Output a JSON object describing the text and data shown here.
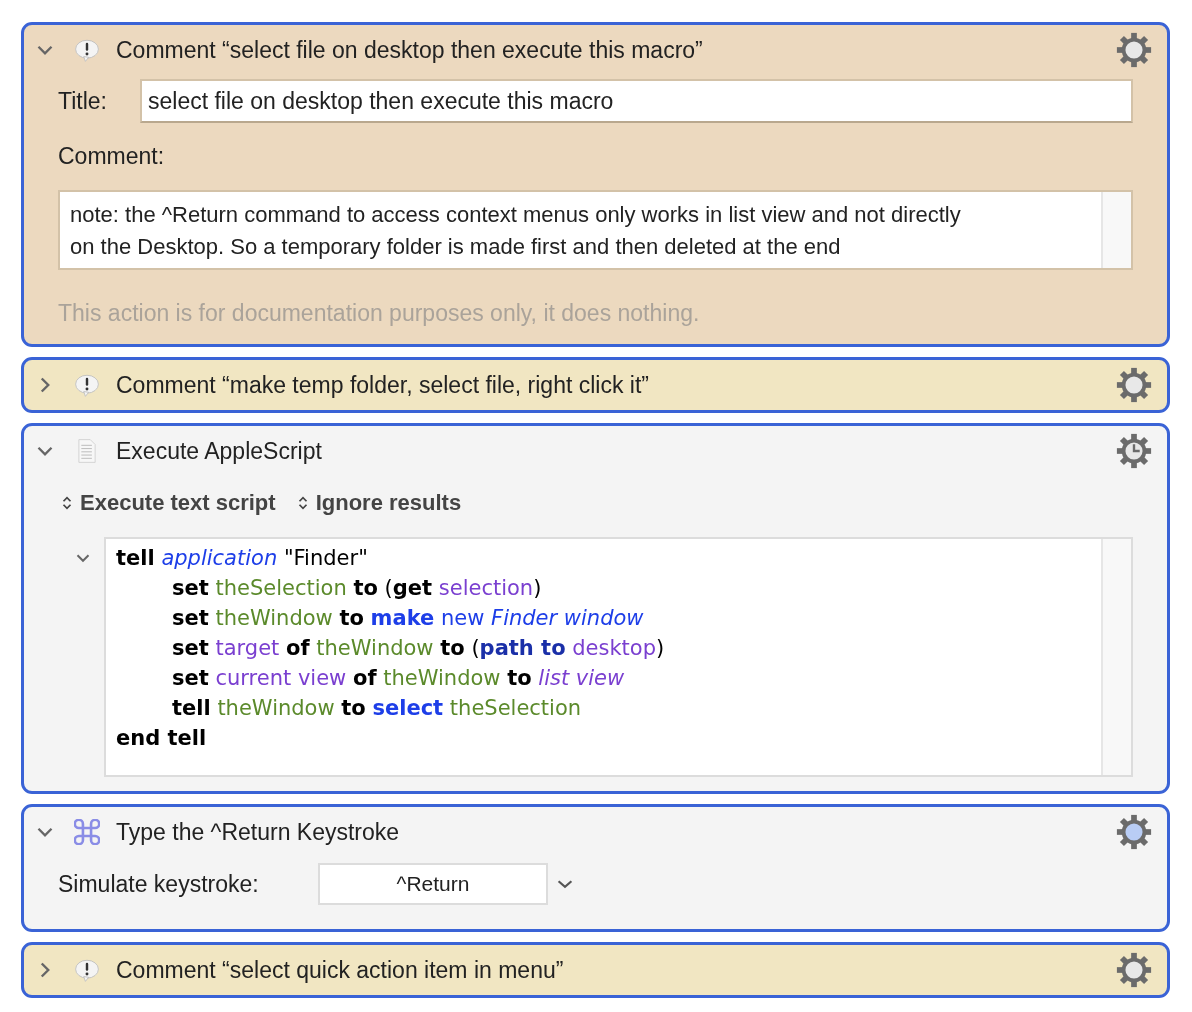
{
  "actions": [
    {
      "kind": "comment",
      "expanded": true,
      "color": "#ecd9bf",
      "highlighted": false,
      "title": "Comment “select file on desktop then execute this macro”",
      "title_label": "Title:",
      "title_value": "select file on desktop then execute this macro",
      "comment_label": "Comment:",
      "comment_value": "note: the ^Return command to access context menus only works in list view and not directly on the Desktop. So a temporary folder is made first and then deleted at the end",
      "note": "This action is for documentation purposes only, it does nothing."
    },
    {
      "kind": "comment",
      "expanded": false,
      "color": "#f1e6c2",
      "highlighted": false,
      "title": "Comment “make temp folder, select file, right click it”"
    },
    {
      "kind": "applescript",
      "expanded": true,
      "color": "#f4f4f4",
      "highlighted": false,
      "title": "Execute AppleScript",
      "options": [
        "Execute text script",
        "Ignore results"
      ],
      "code": [
        {
          "expanded": true,
          "tokens": [
            {
              "text": "tell",
              "kind": "keyword"
            },
            {
              "text": "application",
              "kind": "class"
            },
            {
              "text": "\"Finder\"",
              "kind": "plain"
            }
          ],
          "children": [
            {
              "tokens": [
                {
                  "text": "set",
                  "kind": "keyword"
                },
                {
                  "text": "theSelection",
                  "kind": "variable"
                },
                {
                  "text": "to",
                  "kind": "keyword"
                },
                {
                  "text": "(",
                  "kind": "plain"
                },
                {
                  "text": "get",
                  "kind": "keyword"
                },
                {
                  "text": "selection",
                  "kind": "property"
                },
                {
                  "text": ")",
                  "kind": "plain"
                }
              ]
            },
            {
              "tokens": [
                {
                  "text": "set",
                  "kind": "keyword"
                },
                {
                  "text": "theWindow",
                  "kind": "variable"
                },
                {
                  "text": "to",
                  "kind": "keyword"
                },
                {
                  "text": "make",
                  "kind": "command"
                },
                {
                  "text": "new",
                  "kind": "plain_blue"
                },
                {
                  "text": "Finder window",
                  "kind": "class"
                }
              ]
            },
            {
              "tokens": [
                {
                  "text": "set",
                  "kind": "keyword"
                },
                {
                  "text": "target",
                  "kind": "property"
                },
                {
                  "text": "of",
                  "kind": "keyword"
                },
                {
                  "text": "theWindow",
                  "kind": "variable"
                },
                {
                  "text": "to",
                  "kind": "keyword"
                },
                {
                  "text": "(",
                  "kind": "plain"
                },
                {
                  "text": "path to",
                  "kind": "osax"
                },
                {
                  "text": "desktop",
                  "kind": "property"
                },
                {
                  "text": ")",
                  "kind": "plain"
                }
              ]
            },
            {
              "tokens": [
                {
                  "text": "set",
                  "kind": "keyword"
                },
                {
                  "text": "current view",
                  "kind": "property"
                },
                {
                  "text": "of",
                  "kind": "keyword"
                },
                {
                  "text": "theWindow",
                  "kind": "variable"
                },
                {
                  "text": "to",
                  "kind": "keyword"
                },
                {
                  "text": "list view",
                  "kind": "enum"
                }
              ]
            },
            {
              "tokens": [
                {
                  "text": "tell",
                  "kind": "keyword"
                },
                {
                  "text": "theWindow",
                  "kind": "variable"
                },
                {
                  "text": "to",
                  "kind": "keyword"
                },
                {
                  "text": "select",
                  "kind": "command"
                },
                {
                  "text": "theSelection",
                  "kind": "variable"
                }
              ]
            }
          ]
        },
        {
          "tokens": [
            {
              "text": "end tell",
              "kind": "keyword"
            }
          ]
        }
      ]
    },
    {
      "kind": "keystroke",
      "expanded": true,
      "color": "#f4f4f4",
      "highlighted": true,
      "title": "Type the ^Return Keystroke",
      "field_label": "Simulate keystroke:",
      "field_value": "^Return"
    },
    {
      "kind": "comment",
      "expanded": false,
      "color": "#f1e6c2",
      "highlighted": false,
      "title": "Comment “select quick action item in menu”"
    }
  ]
}
